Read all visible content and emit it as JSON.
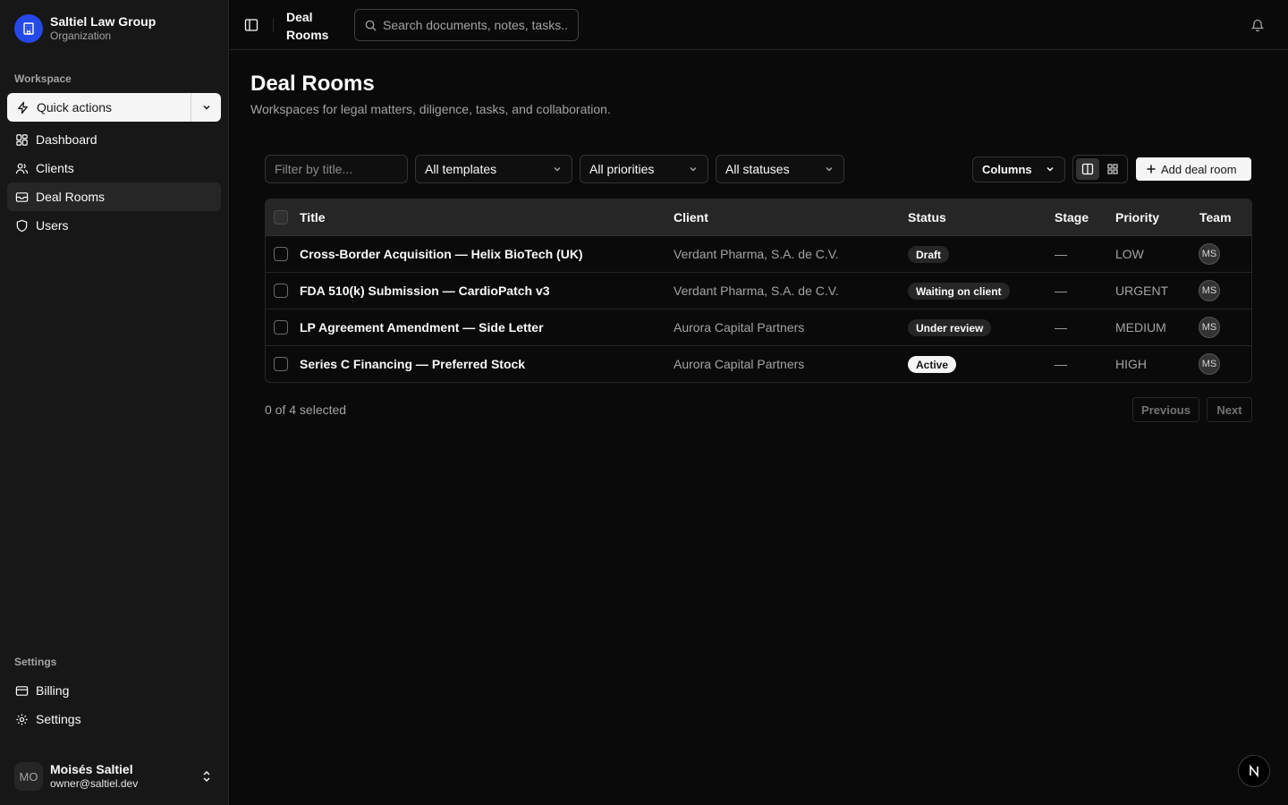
{
  "org": {
    "name": "Saltiel Law Group",
    "subtitle": "Organization",
    "logo_icon": "building-icon",
    "logo_color": "#2548e8"
  },
  "sidebar": {
    "workspace_label": "Workspace",
    "quick_actions_label": "Quick actions",
    "nav": [
      {
        "label": "Dashboard",
        "icon": "dashboard-icon"
      },
      {
        "label": "Clients",
        "icon": "users-icon"
      },
      {
        "label": "Deal Rooms",
        "icon": "inbox-icon",
        "active": true
      },
      {
        "label": "Users",
        "icon": "shield-icon"
      }
    ],
    "settings_label": "Settings",
    "settings_nav": [
      {
        "label": "Billing",
        "icon": "credit-card-icon"
      },
      {
        "label": "Settings",
        "icon": "gear-icon"
      }
    ],
    "user": {
      "initials": "MO",
      "name": "Moisés Saltiel",
      "email": "owner@saltiel.dev"
    }
  },
  "header": {
    "breadcrumb": "Deal Rooms",
    "search_placeholder": "Search documents, notes, tasks..."
  },
  "main": {
    "title": "Deal Rooms",
    "subtitle": "Workspaces for legal matters, diligence, tasks, and collaboration.",
    "filter_placeholder": "Filter by title...",
    "template_filter": "All templates",
    "priority_filter": "All priorities",
    "status_filter": "All statuses",
    "columns_label": "Columns",
    "add_label": "Add deal room"
  },
  "table": {
    "columns": [
      "Title",
      "Client",
      "Status",
      "Stage",
      "Priority",
      "Team"
    ],
    "rows": [
      {
        "title": "Cross-Border Acquisition — Helix BioTech (UK)",
        "client": "Verdant Pharma, S.A. de C.V.",
        "status": "Draft",
        "stage": "—",
        "priority": "LOW",
        "team": "MS"
      },
      {
        "title": "FDA 510(k) Submission — CardioPatch v3",
        "client": "Verdant Pharma, S.A. de C.V.",
        "status": "Waiting on client",
        "stage": "—",
        "priority": "URGENT",
        "team": "MS"
      },
      {
        "title": "LP Agreement Amendment — Side Letter",
        "client": "Aurora Capital Partners",
        "status": "Under review",
        "stage": "—",
        "priority": "MEDIUM",
        "team": "MS"
      },
      {
        "title": "Series C Financing — Preferred Stock",
        "client": "Aurora Capital Partners",
        "status": "Active",
        "stage": "—",
        "priority": "HIGH",
        "team": "MS"
      }
    ]
  },
  "pagination": {
    "selected_text": "0 of 4 selected",
    "previous": "Previous",
    "next": "Next"
  },
  "fab": {
    "label": "N"
  },
  "colors": {
    "background": "#0a0a0a",
    "sidebar": "#171717",
    "accent": "#2548e8",
    "primary_button": "#f5f5f5"
  }
}
